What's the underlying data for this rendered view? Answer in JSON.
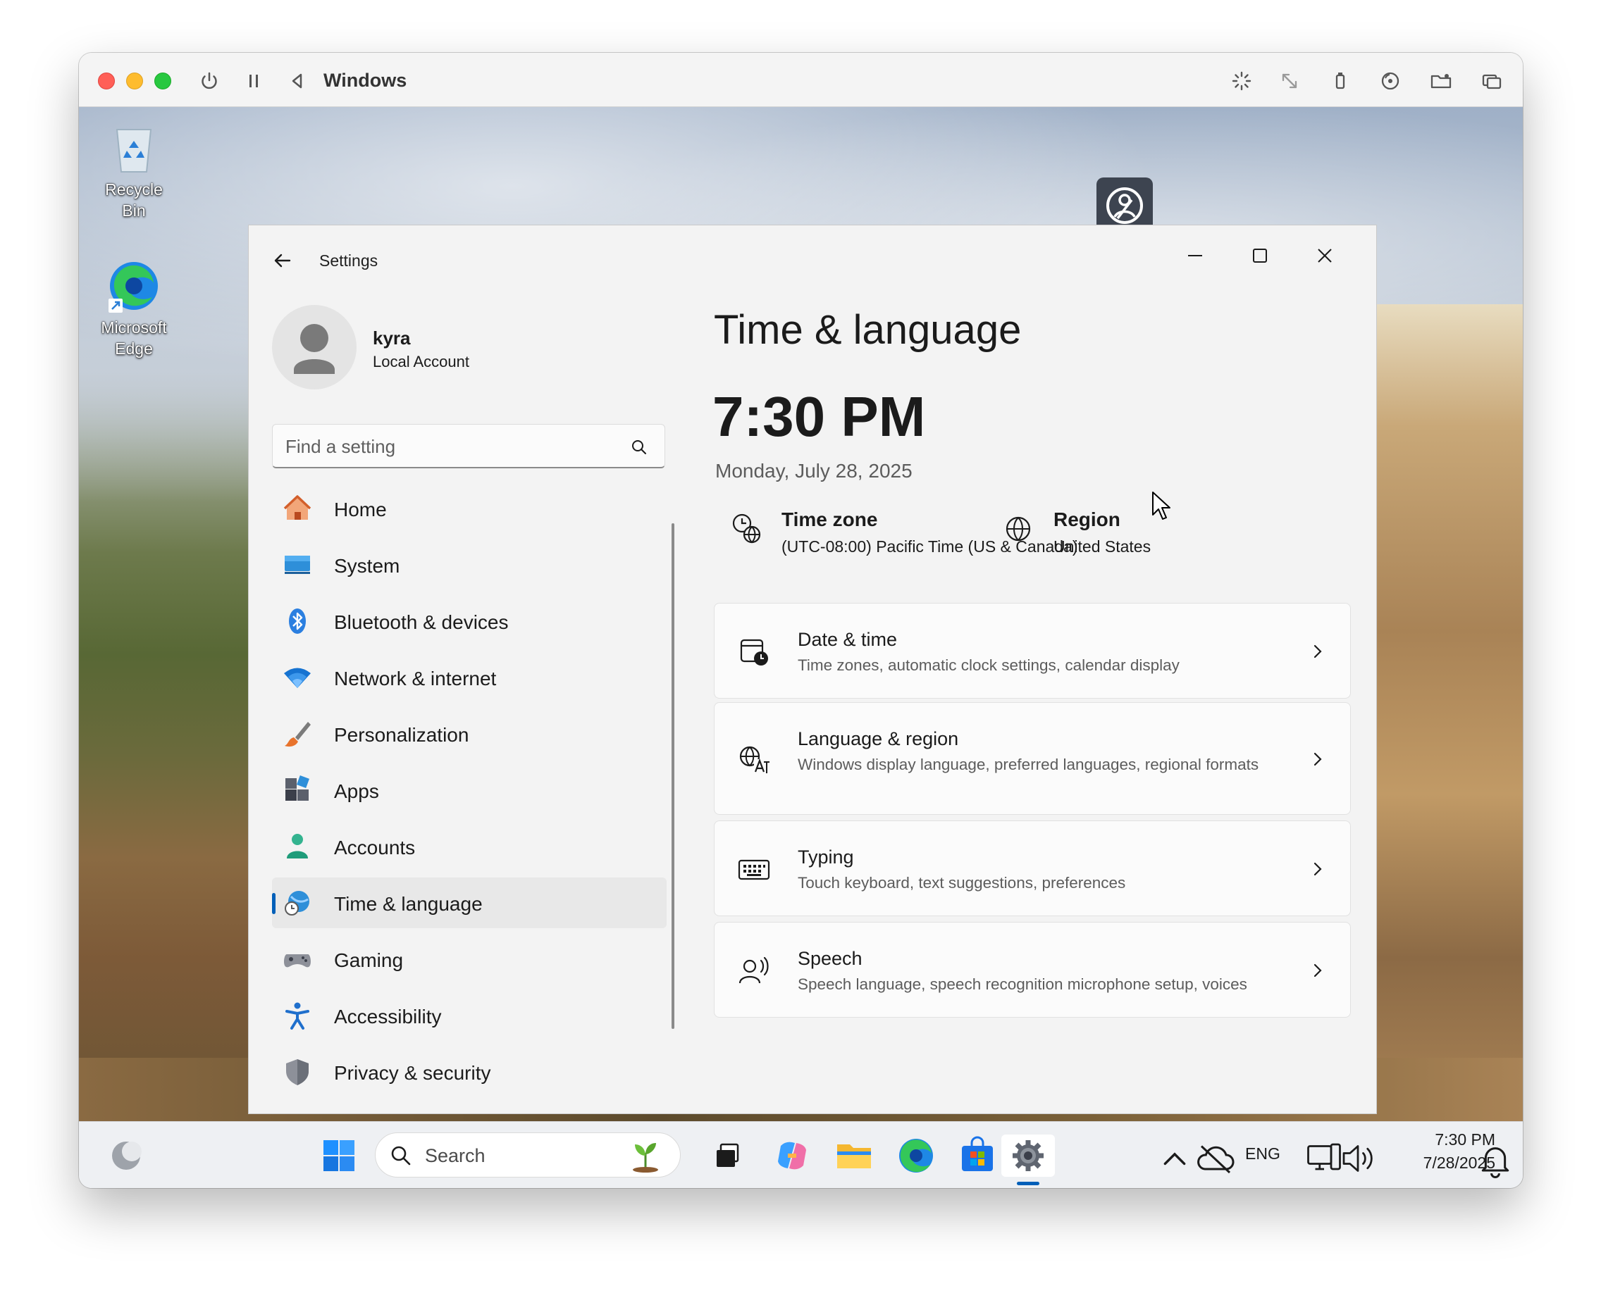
{
  "vm": {
    "title": "Windows"
  },
  "desktop": {
    "icons": [
      {
        "label": "Recycle Bin"
      },
      {
        "label": "Microsoft Edge"
      }
    ]
  },
  "settings": {
    "window_title": "Settings",
    "user": {
      "name": "kyra",
      "account_type": "Local Account"
    },
    "search": {
      "placeholder": "Find a setting"
    },
    "nav": [
      {
        "label": "Home",
        "icon": "home-icon"
      },
      {
        "label": "System",
        "icon": "system-icon"
      },
      {
        "label": "Bluetooth & devices",
        "icon": "bluetooth-icon"
      },
      {
        "label": "Network & internet",
        "icon": "wifi-icon"
      },
      {
        "label": "Personalization",
        "icon": "brush-icon"
      },
      {
        "label": "Apps",
        "icon": "apps-icon"
      },
      {
        "label": "Accounts",
        "icon": "accounts-icon"
      },
      {
        "label": "Time & language",
        "icon": "time-language-icon",
        "selected": true
      },
      {
        "label": "Gaming",
        "icon": "gamepad-icon"
      },
      {
        "label": "Accessibility",
        "icon": "accessibility-icon"
      },
      {
        "label": "Privacy & security",
        "icon": "shield-icon"
      }
    ],
    "page": {
      "title": "Time & language",
      "time": "7:30 PM",
      "date": "Monday, July 28, 2025",
      "time_zone": {
        "label": "Time zone",
        "value": "(UTC-08:00) Pacific Time (US & Canada)"
      },
      "region": {
        "label": "Region",
        "value": "United States"
      },
      "cards": [
        {
          "title": "Date & time",
          "subtitle": "Time zones, automatic clock settings, calendar display"
        },
        {
          "title": "Language & region",
          "subtitle": "Windows display language, preferred languages, regional formats"
        },
        {
          "title": "Typing",
          "subtitle": "Touch keyboard, text suggestions, preferences"
        },
        {
          "title": "Speech",
          "subtitle": "Speech language, speech recognition microphone setup, voices"
        }
      ]
    }
  },
  "taskbar": {
    "search_label": "Search",
    "language": "ENG",
    "time": "7:30 PM",
    "date": "7/28/2025"
  },
  "colors": {
    "accent": "#005fb8",
    "window_bg": "#f3f3f3",
    "card_bg": "#fbfbfb"
  }
}
